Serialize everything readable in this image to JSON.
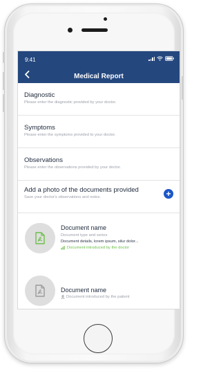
{
  "colors": {
    "header_bg": "#24477e",
    "accent": "#1d57c9",
    "success": "#6bbf4a"
  },
  "status_bar": {
    "time": "9:41"
  },
  "header": {
    "title": "Medical Report",
    "back_icon": "chevron-left-icon"
  },
  "sections": [
    {
      "title": "Diagnostic",
      "hint": "Please enter the diagnostic provided by your doctor."
    },
    {
      "title": "Symptoms",
      "hint": "Please enter the symptoms provided to your doctor."
    },
    {
      "title": "Observations",
      "hint": "Please enter the observations provided by your doctor."
    }
  ],
  "add_photo": {
    "title": "Add a photo of the documents provided",
    "hint": "Save your doctor's observations and notes.",
    "button": "+"
  },
  "documents": [
    {
      "name": "Document name",
      "type": "Document type and series",
      "details": "Document details, lorem ipsum, silur dolor...",
      "status": "Document introduced by the doctor",
      "icon": "pdf-icon"
    },
    {
      "name": "Document name",
      "status": "Document introduced by the patient",
      "icon": "pdf-icon"
    }
  ]
}
